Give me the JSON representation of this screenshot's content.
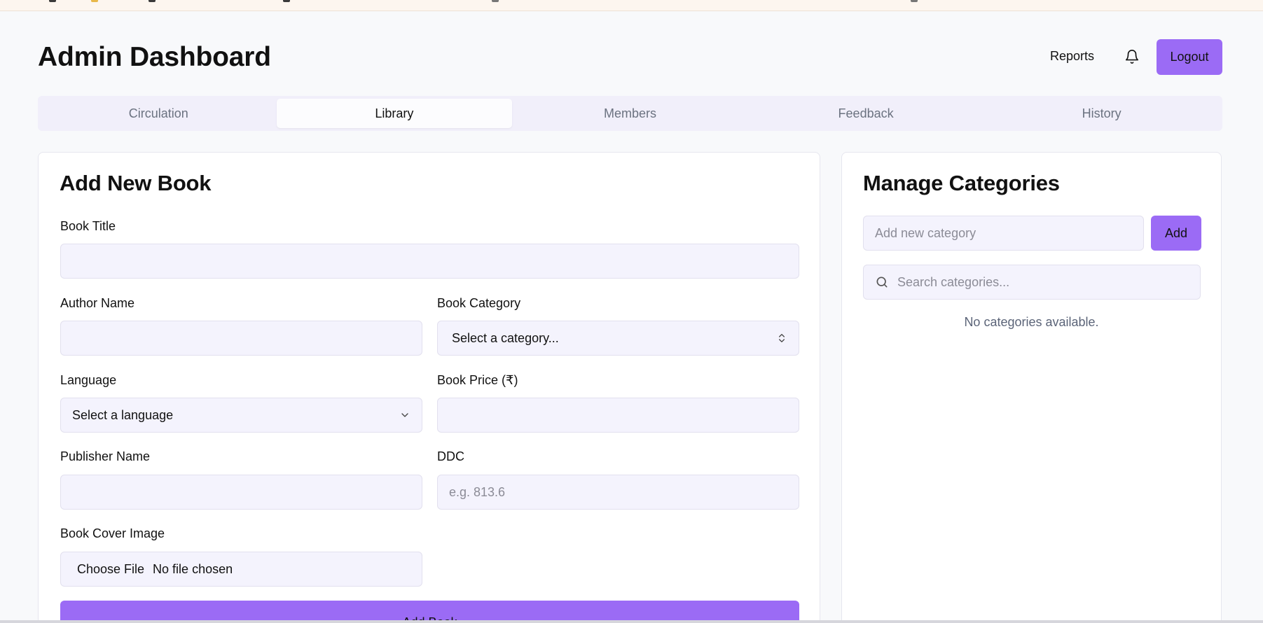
{
  "header": {
    "title": "Admin Dashboard",
    "reports_label": "Reports",
    "bell_icon": "bell-icon",
    "logout_label": "Logout"
  },
  "tabs": [
    {
      "label": "Circulation",
      "active": false
    },
    {
      "label": "Library",
      "active": true
    },
    {
      "label": "Members",
      "active": false
    },
    {
      "label": "Feedback",
      "active": false
    },
    {
      "label": "History",
      "active": false
    }
  ],
  "add_book": {
    "title": "Add New Book",
    "fields": {
      "book_title": {
        "label": "Book Title",
        "value": ""
      },
      "author_name": {
        "label": "Author Name",
        "value": ""
      },
      "book_category": {
        "label": "Book Category",
        "selected": "Select a category..."
      },
      "language": {
        "label": "Language",
        "selected": "Select a language"
      },
      "book_price": {
        "label": "Book Price (₹)",
        "value": ""
      },
      "publisher_name": {
        "label": "Publisher Name",
        "value": ""
      },
      "ddc": {
        "label": "DDC",
        "placeholder": "e.g. 813.6",
        "value": ""
      },
      "cover_image": {
        "label": "Book Cover Image",
        "button_label": "Choose File",
        "status": "No file chosen"
      }
    },
    "submit_label": "Add Book"
  },
  "categories": {
    "title": "Manage Categories",
    "new_placeholder": "Add new category",
    "add_label": "Add",
    "search_placeholder": "Search categories...",
    "empty_message": "No categories available."
  },
  "colors": {
    "accent": "#9b6bf5",
    "field_bg": "#f4f3fd",
    "tabs_bg": "#f1effa",
    "page_bg": "#f8f9fb"
  }
}
